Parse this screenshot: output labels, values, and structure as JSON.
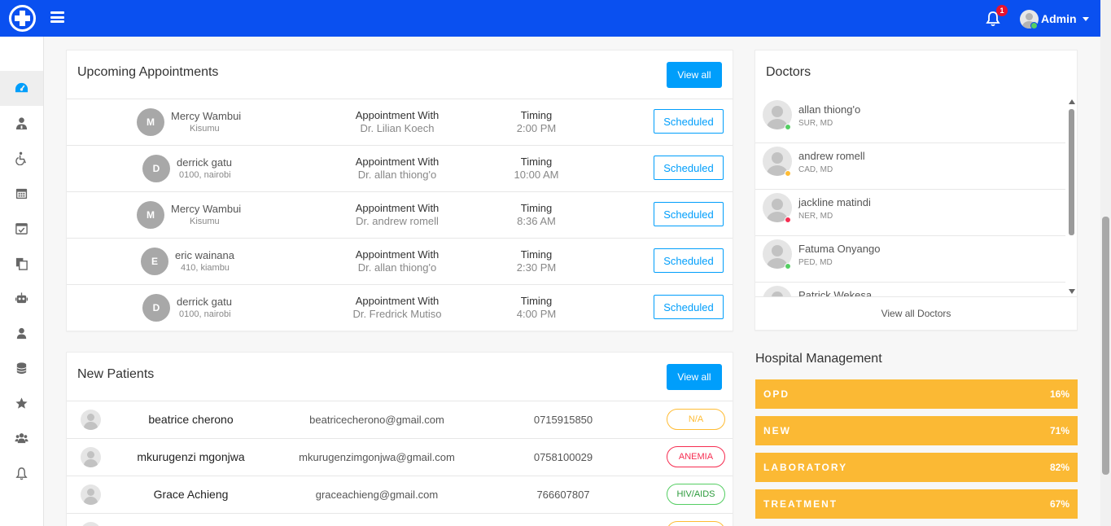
{
  "header": {
    "notification_count": "1",
    "user_name": "Admin",
    "colors": {
      "bar": "#0a50f0",
      "badge": "#e8122e"
    }
  },
  "sidebar": {
    "items": [
      {
        "icon": "dashboard-icon",
        "active": true
      },
      {
        "icon": "user-doctor-icon",
        "active": false
      },
      {
        "icon": "wheelchair-icon",
        "active": false
      },
      {
        "icon": "calendar-icon",
        "active": false
      },
      {
        "icon": "calendar-check-icon",
        "active": false
      },
      {
        "icon": "copy-icon",
        "active": false
      },
      {
        "icon": "robot-icon",
        "active": false
      },
      {
        "icon": "user-icon",
        "active": false
      },
      {
        "icon": "database-icon",
        "active": false
      },
      {
        "icon": "star-icon",
        "active": false
      },
      {
        "icon": "users-icon",
        "active": false
      },
      {
        "icon": "bell-icon",
        "active": false
      }
    ]
  },
  "appointments": {
    "title": "Upcoming Appointments",
    "view_all_label": "View all",
    "rows": [
      {
        "initial": "M",
        "name": "Mercy Wambui",
        "location": "Kisumu",
        "with_label": "Appointment With",
        "doctor": "Dr. Lilian Koech",
        "timing_label": "Timing",
        "time": "2:00 PM",
        "status": "Scheduled"
      },
      {
        "initial": "D",
        "name": "derrick gatu",
        "location": "0100, nairobi",
        "with_label": "Appointment With",
        "doctor": "Dr. allan thiong'o",
        "timing_label": "Timing",
        "time": "10:00 AM",
        "status": "Scheduled"
      },
      {
        "initial": "M",
        "name": "Mercy Wambui",
        "location": "Kisumu",
        "with_label": "Appointment With",
        "doctor": "Dr. andrew romell",
        "timing_label": "Timing",
        "time": "8:36 AM",
        "status": "Scheduled"
      },
      {
        "initial": "E",
        "name": "eric wainana",
        "location": "410, kiambu",
        "with_label": "Appointment With",
        "doctor": "Dr. allan thiong'o",
        "timing_label": "Timing",
        "time": "2:30 PM",
        "status": "Scheduled"
      },
      {
        "initial": "D",
        "name": "derrick gatu",
        "location": "0100, nairobi",
        "with_label": "Appointment With",
        "doctor": "Dr. Fredrick Mutiso",
        "timing_label": "Timing",
        "time": "4:00 PM",
        "status": "Scheduled"
      }
    ]
  },
  "doctors": {
    "title": "Doctors",
    "view_all_label": "View all Doctors",
    "items": [
      {
        "name": "allan thiong'o",
        "specialty": "SUR, MD",
        "status_color": "#55ce63"
      },
      {
        "name": "andrew romell",
        "specialty": "CAD, MD",
        "status_color": "#ffbc34"
      },
      {
        "name": "jackline matindi",
        "specialty": "NER, MD",
        "status_color": "#f62d51"
      },
      {
        "name": "Fatuma Onyango",
        "specialty": "PED, MD",
        "status_color": "#55ce63"
      },
      {
        "name": "Patrick Wekesa",
        "specialty": "",
        "status_color": "#55ce63"
      }
    ]
  },
  "patients": {
    "title": "New Patients",
    "view_all_label": "View all",
    "rows": [
      {
        "name": "beatrice cherono",
        "email": "beatricecherono@gmail.com",
        "phone": "0715915850",
        "tag": "N/A",
        "tag_color": "#ffbc34"
      },
      {
        "name": "mkurugenzi mgonjwa",
        "email": "mkurugenzimgonjwa@gmail.com",
        "phone": "0758100029",
        "tag": "ANEMIA",
        "tag_color": "#f62d51"
      },
      {
        "name": "Grace Achieng",
        "email": "graceachieng@gmail.com",
        "phone": "766607807",
        "tag": "HIV/AIDS",
        "tag_color": "#55ce63"
      },
      {
        "name": "",
        "email": "",
        "phone": "",
        "tag": "",
        "tag_color": "#ffbc34"
      }
    ]
  },
  "hospital_management": {
    "title": "Hospital Management",
    "bar_color": "#fbb934",
    "items": [
      {
        "label": "OPD",
        "value": "16%"
      },
      {
        "label": "NEW",
        "value": "71%"
      },
      {
        "label": "LABORATORY",
        "value": "82%"
      },
      {
        "label": "TREATMENT",
        "value": "67%"
      }
    ]
  }
}
